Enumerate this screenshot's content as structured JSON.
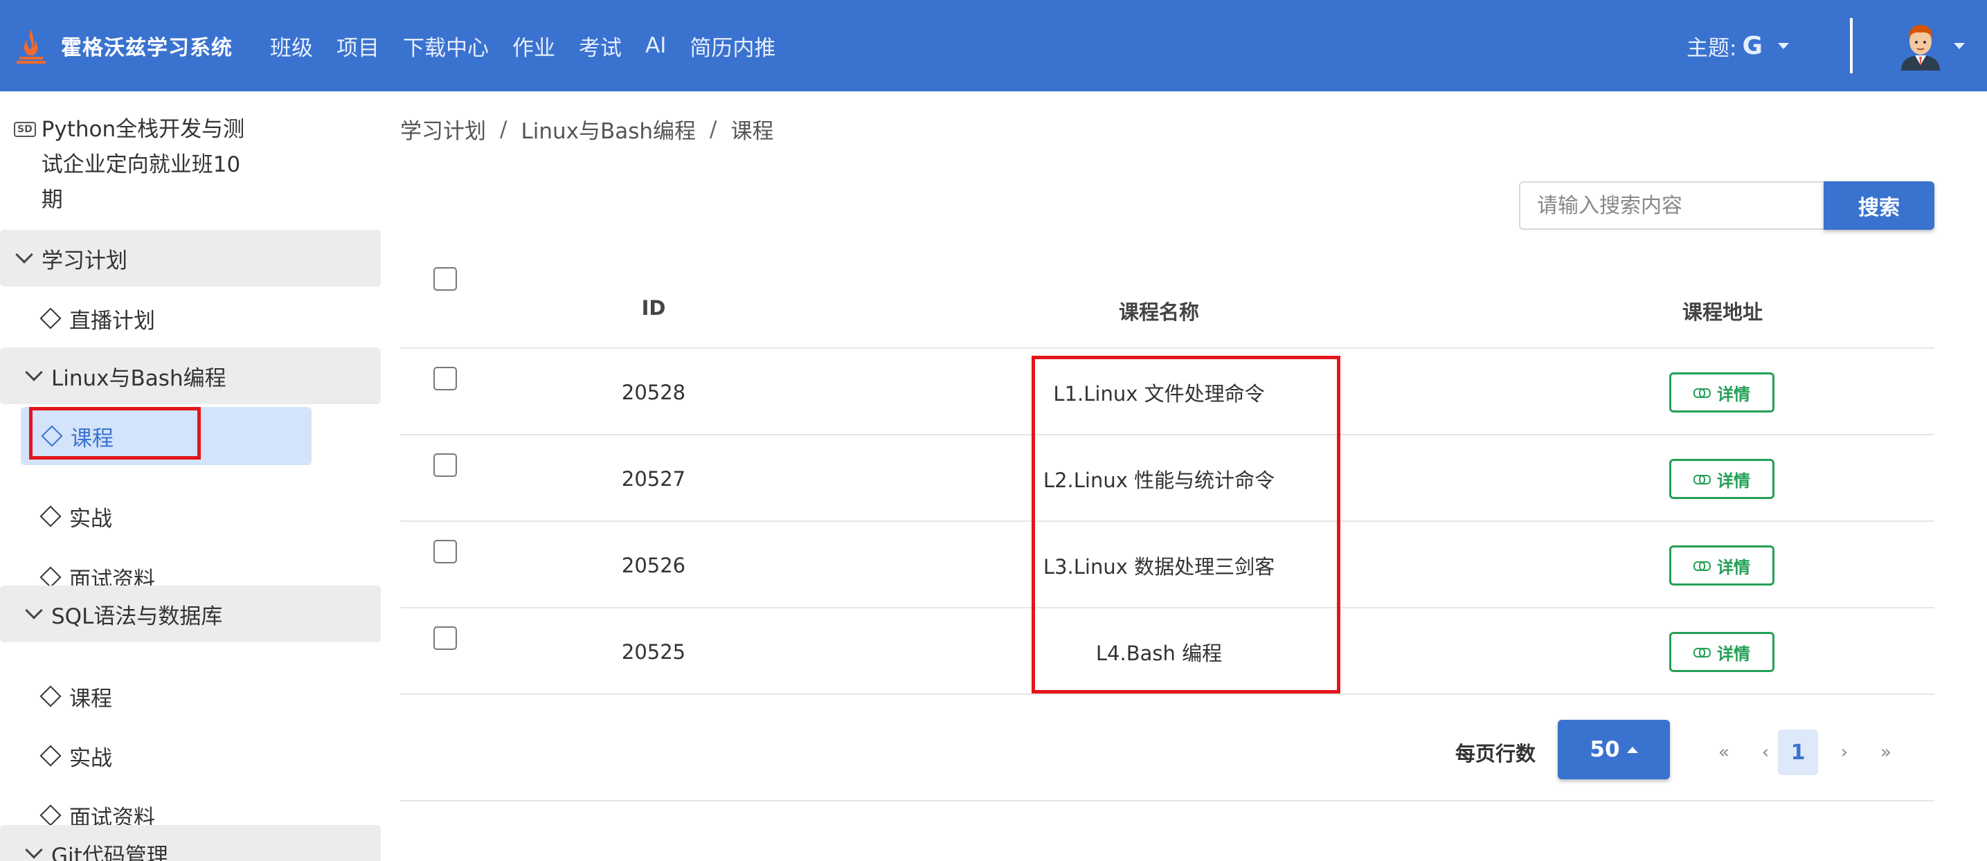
{
  "header": {
    "brand_name": "霍格沃兹学习系统",
    "nav": [
      "班级",
      "项目",
      "下载中心",
      "作业",
      "考试",
      "AI",
      "简历内推"
    ],
    "theme_label": "主题:",
    "theme_value": "G"
  },
  "sidebar": {
    "class_badge": "SD",
    "class_title": "Python全栈开发与测试企业定向就业班10期",
    "groups": [
      {
        "label": "学习计划",
        "items": [
          "直播计划"
        ]
      },
      {
        "label": "Linux与Bash编程",
        "items": [
          "课程",
          "实战",
          "面试资料"
        ]
      },
      {
        "label": "SQL语法与数据库",
        "items": [
          "课程",
          "实战",
          "面试资料"
        ]
      },
      {
        "label": "Git代码管理",
        "items": []
      }
    ]
  },
  "breadcrumb": [
    "学习计划",
    "Linux与Bash编程",
    "课程"
  ],
  "search": {
    "placeholder": "请输入搜索内容",
    "button": "搜索"
  },
  "table": {
    "headers": [
      "ID",
      "课程名称",
      "课程地址"
    ],
    "rows": [
      {
        "id": "20528",
        "name": "L1.Linux 文件处理命令",
        "action": "详情"
      },
      {
        "id": "20527",
        "name": "L2.Linux 性能与统计命令",
        "action": "详情"
      },
      {
        "id": "20526",
        "name": "L3.Linux 数据处理三剑客",
        "action": "详情"
      },
      {
        "id": "20525",
        "name": "L4.Bash 编程",
        "action": "详情"
      }
    ]
  },
  "pagination": {
    "rows_label": "每页行数",
    "rows_value": "50",
    "first": "«",
    "prev": "‹",
    "current_page": "1",
    "next": "›",
    "last": "»"
  },
  "colors": {
    "header_bg": "#3a72cf",
    "active_bg": "#d3e3fa",
    "highlight_red": "#e3151b",
    "detail_green": "#23a055"
  }
}
